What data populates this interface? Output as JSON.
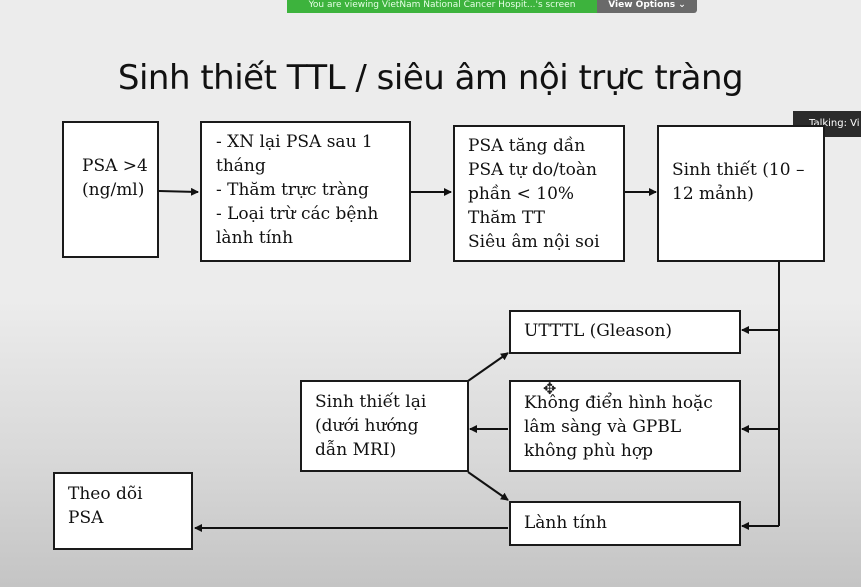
{
  "screen_share": {
    "banner_text": "You are viewing VietNam National Cancer Hospit...'s screen",
    "view_options_label": "View Options ⌄",
    "talking_label": "Talking: Vi"
  },
  "slide": {
    "title": "Sinh thiết TTL / siêu âm nội trực tràng",
    "boxes": {
      "psa_gt4": [
        "PSA >4",
        "(ng/ml)"
      ],
      "repeat_test": [
        "- XN lại PSA sau 1",
        "tháng",
        "- Thăm trực tràng",
        "- Loại trừ các bệnh",
        "lành tính"
      ],
      "psa_rising": [
        "PSA tăng dần",
        "PSA tự do/toàn",
        "phần < 10%",
        "Thăm TT",
        "Siêu âm nội soi"
      ],
      "biopsy": [
        "Sinh thiết (10 –",
        "12 mảnh)"
      ],
      "cancer": [
        "UTTTL (Gleason)"
      ],
      "atypical": [
        "Không điển hình hoặc",
        "lâm sàng và GPBL",
        "không phù hợp"
      ],
      "rebiopsy": [
        "Sinh thiết lại",
        "(dưới hướng",
        "dẫn MRI)"
      ],
      "benign": [
        "Lành tính"
      ],
      "monitor": [
        "Theo dõi",
        "PSA"
      ]
    }
  }
}
